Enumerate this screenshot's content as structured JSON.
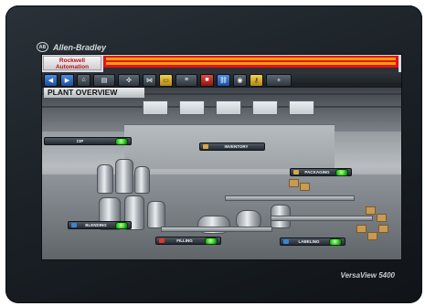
{
  "device": {
    "brand": "Allen-Bradley",
    "brand_logo_text": "AB",
    "model": "VersaView 5400"
  },
  "hmi": {
    "logo": "Rockwell Automation",
    "screen_title": "PLANT OVERVIEW",
    "alarm_color": "#e3121b",
    "nav_buttons": [
      {
        "icon": "back-arrow-icon"
      },
      {
        "icon": "forward-arrow-icon"
      },
      {
        "icon": "home-icon"
      },
      {
        "icon": "tank-icon"
      },
      {
        "icon": "mixer-icon"
      },
      {
        "icon": "valve-icon"
      },
      {
        "icon": "folder-icon"
      },
      {
        "icon": "conveyor-icon"
      },
      {
        "icon": "stop-icon"
      },
      {
        "icon": "network-icon"
      },
      {
        "icon": "camera-icon"
      },
      {
        "icon": "key-icon"
      },
      {
        "icon": "settings-icon"
      }
    ],
    "areas": [
      {
        "label": "CIP",
        "status_color": "#28c21e"
      },
      {
        "label": "INVENTORY",
        "status_color": ""
      },
      {
        "label": "PACKAGING",
        "status_color": "#28c21e"
      },
      {
        "label": "BLENDING",
        "status_color": "#28c21e"
      },
      {
        "label": "FILLING",
        "status_color": "#28c21e"
      },
      {
        "label": "LABELING",
        "status_color": "#28c21e"
      }
    ]
  }
}
